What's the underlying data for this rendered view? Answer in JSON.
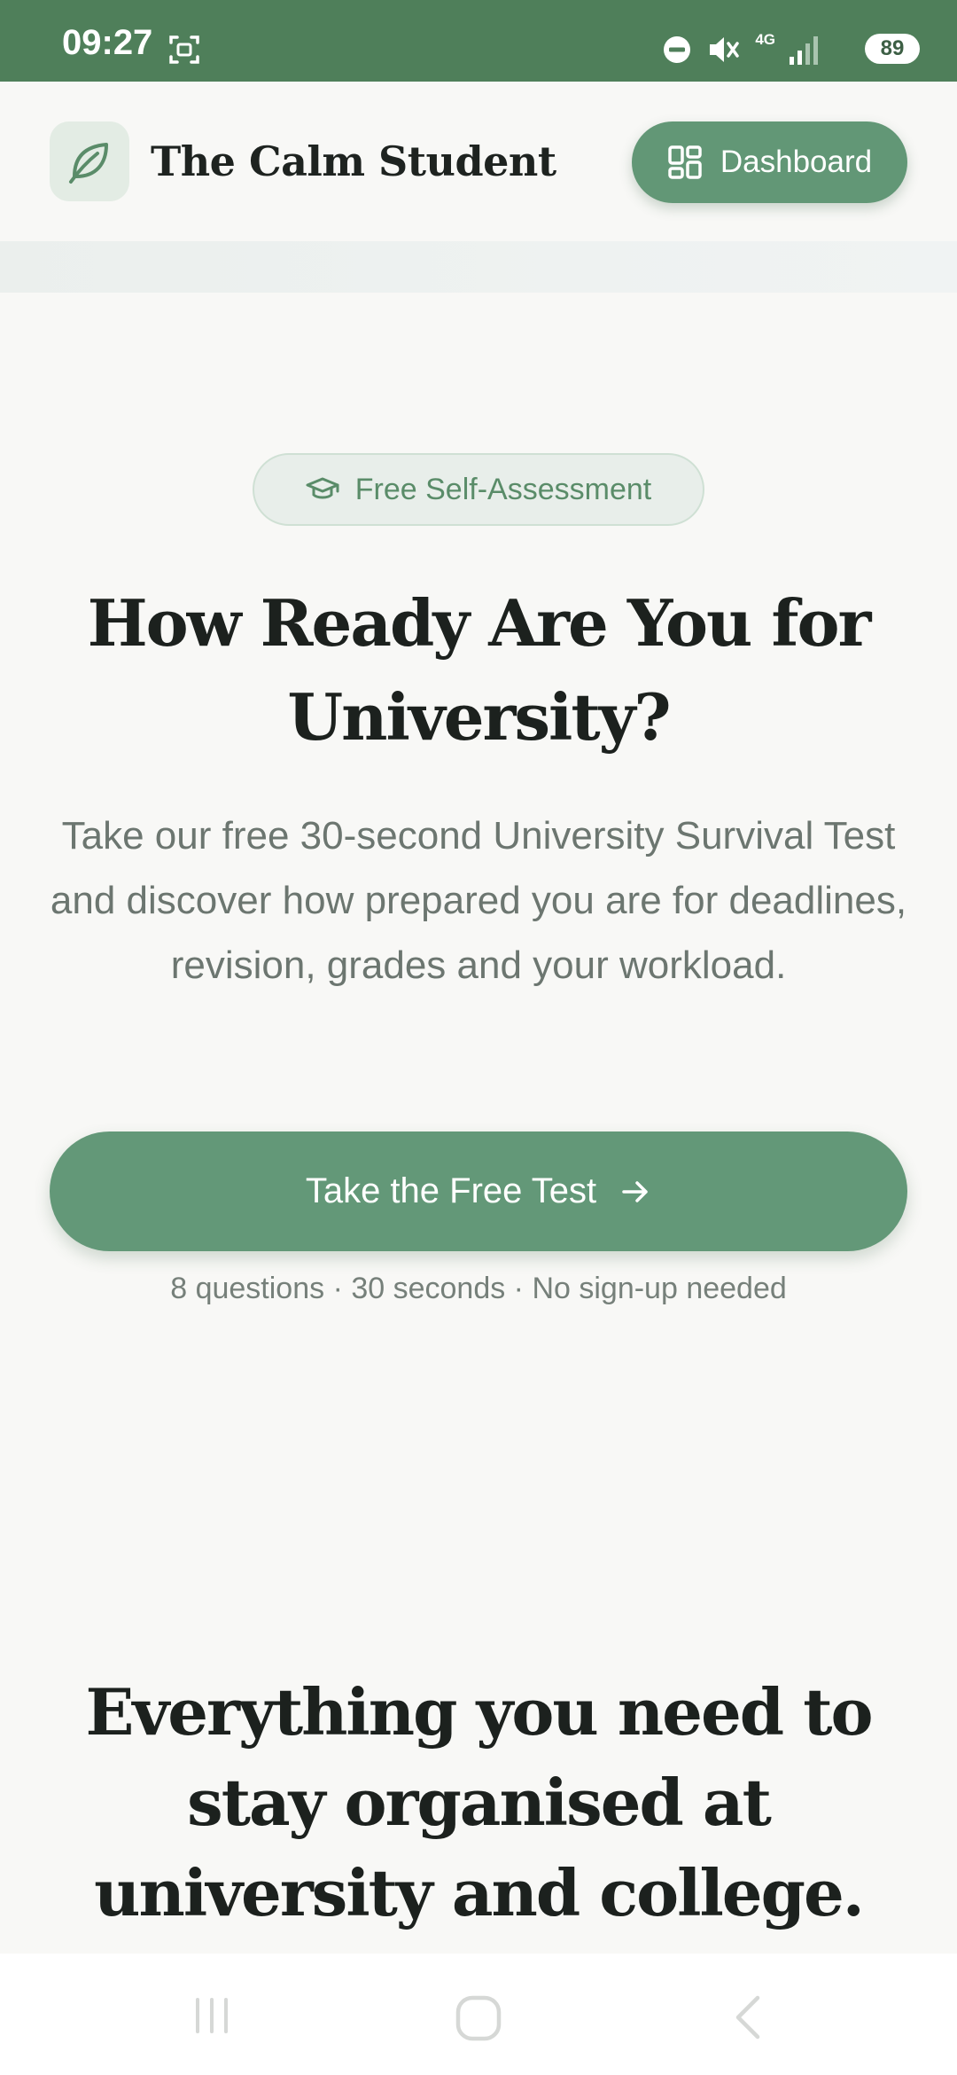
{
  "status_bar": {
    "time": "09:27",
    "network": "4G",
    "battery": "89"
  },
  "header": {
    "brand": "The Calm Student",
    "dashboard_label": "Dashboard"
  },
  "hero": {
    "badge": "Free Self-Assessment",
    "title": "How Ready Are You for University?",
    "subtitle": "Take our free 30-second University Survival Test and discover how prepared you are for deadlines, revision, grades and your workload.",
    "cta_label": "Take the Free Test",
    "meta": "8 questions · 30 seconds · No sign-up needed"
  },
  "features": {
    "title": "Everything you need to stay organised at university and college."
  },
  "colors": {
    "status_bar": "#4f7f5a",
    "accent": "#629776",
    "background": "#f8f8f6"
  },
  "icons": {
    "logo": "leaf-icon",
    "dashboard": "grid-icon",
    "badge": "graduation-cap-icon",
    "cta": "arrow-right-icon"
  }
}
